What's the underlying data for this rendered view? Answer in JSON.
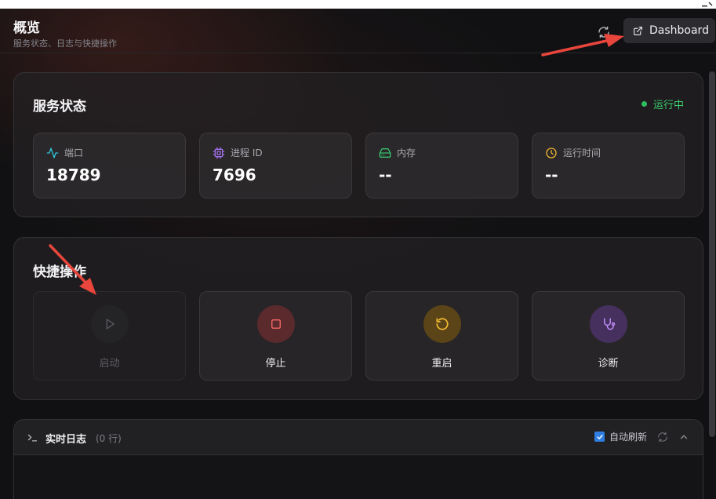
{
  "header": {
    "title": "概览",
    "subtitle": "服务状态、日志与快捷操作",
    "dashboard_label": "Dashboard"
  },
  "service": {
    "title": "服务状态",
    "status": "运行中",
    "status_color": "#3ecf6e",
    "stats": [
      {
        "icon": "activity-icon",
        "label": "端口",
        "value": "18789",
        "color": "#2fc4d6"
      },
      {
        "icon": "cpu-icon",
        "label": "进程 ID",
        "value": "7696",
        "color": "#a070e8"
      },
      {
        "icon": "hard-drive-icon",
        "label": "内存",
        "value": "--",
        "color": "#34c26a"
      },
      {
        "icon": "clock-icon",
        "label": "运行时间",
        "value": "--",
        "color": "#f0b52e"
      }
    ]
  },
  "quick": {
    "title": "快捷操作",
    "actions": [
      {
        "icon": "play-icon",
        "label": "启动",
        "disabled": true
      },
      {
        "icon": "stop-icon",
        "label": "停止",
        "color": "#e05858"
      },
      {
        "icon": "restart-icon",
        "label": "重启",
        "color": "#f0b52e"
      },
      {
        "icon": "stethoscope-icon",
        "label": "诊断",
        "color": "#b57ef5"
      }
    ]
  },
  "log": {
    "title": "实时日志",
    "count": "(0 行)",
    "auto_refresh_label": "自动刷新",
    "auto_refresh": true
  }
}
